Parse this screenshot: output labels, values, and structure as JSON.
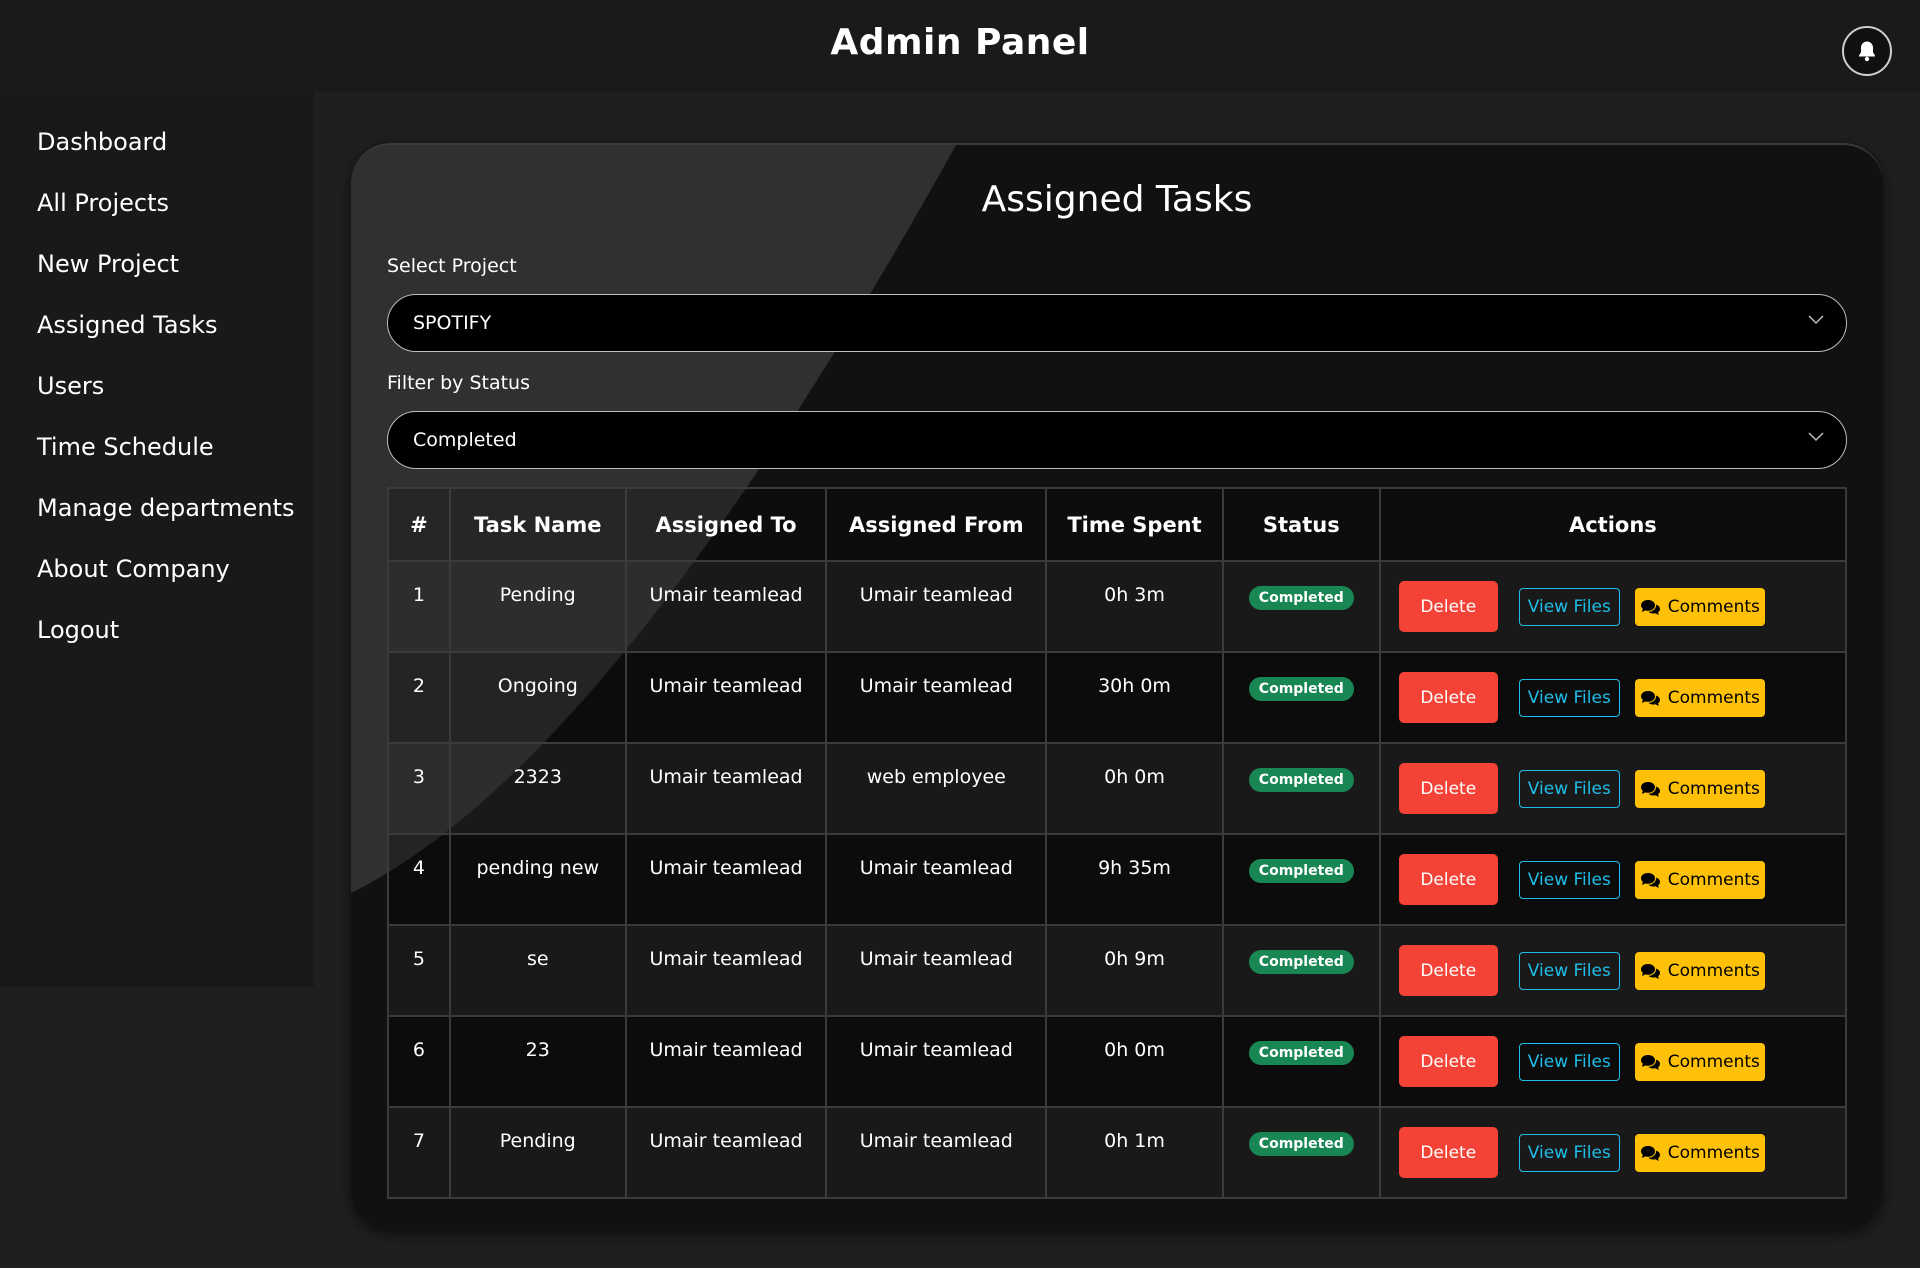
{
  "header": {
    "title": "Admin Panel"
  },
  "sidebar": {
    "items": [
      {
        "label": "Dashboard"
      },
      {
        "label": "All Projects"
      },
      {
        "label": "New Project"
      },
      {
        "label": "Assigned Tasks"
      },
      {
        "label": "Users"
      },
      {
        "label": "Time Schedule"
      },
      {
        "label": "Manage departments"
      },
      {
        "label": "About Company"
      },
      {
        "label": "Logout"
      }
    ]
  },
  "main": {
    "title": "Assigned Tasks",
    "project_select": {
      "label": "Select Project",
      "value": "SPOTIFY"
    },
    "status_select": {
      "label": "Filter by Status",
      "value": "Completed"
    },
    "table": {
      "headers": [
        "#",
        "Task Name",
        "Assigned To",
        "Assigned From",
        "Time Spent",
        "Status",
        "Actions"
      ],
      "rows": [
        {
          "num": "1",
          "task": "Pending",
          "to": "Umair teamlead",
          "from": "Umair teamlead",
          "time": "0h 3m",
          "status": "Completed"
        },
        {
          "num": "2",
          "task": "Ongoing",
          "to": "Umair teamlead",
          "from": "Umair teamlead",
          "time": "30h 0m",
          "status": "Completed"
        },
        {
          "num": "3",
          "task": "2323",
          "to": "Umair teamlead",
          "from": "web employee",
          "time": "0h 0m",
          "status": "Completed"
        },
        {
          "num": "4",
          "task": "pending new",
          "to": "Umair teamlead",
          "from": "Umair teamlead",
          "time": "9h 35m",
          "status": "Completed"
        },
        {
          "num": "5",
          "task": "se",
          "to": "Umair teamlead",
          "from": "Umair teamlead",
          "time": "0h 9m",
          "status": "Completed"
        },
        {
          "num": "6",
          "task": "23",
          "to": "Umair teamlead",
          "from": "Umair teamlead",
          "time": "0h 0m",
          "status": "Completed"
        },
        {
          "num": "7",
          "task": "Pending",
          "to": "Umair teamlead",
          "from": "Umair teamlead",
          "time": "0h 1m",
          "status": "Completed"
        }
      ]
    },
    "actions": {
      "delete_label": "Delete",
      "files_label": "View Files",
      "comments_label": "Comments"
    }
  },
  "colors": {
    "delete": "#f44336",
    "files": "#1ebee8",
    "comments": "#ffc107",
    "status_completed": "#198754"
  },
  "icons": {
    "header": "bell-icon",
    "select": "chevron-down-icon",
    "comments": "comments-icon"
  }
}
